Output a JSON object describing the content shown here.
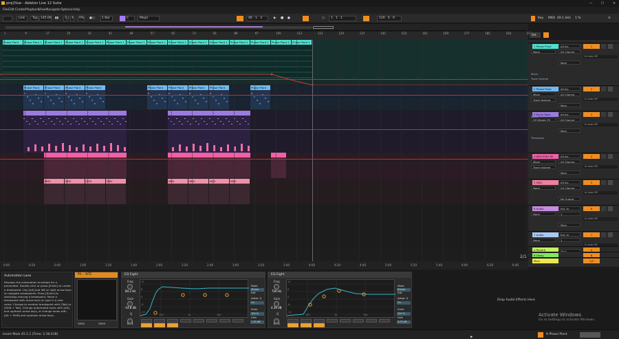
{
  "window": {
    "title": "proj2Vue - Ableton Live 12 Suite",
    "min": "—",
    "max": "☐",
    "close": "✕"
  },
  "menu": [
    "File",
    "Edit",
    "Create",
    "Playback",
    "View",
    "Navigate",
    "Options",
    "Help"
  ],
  "transport": {
    "link": "Link",
    "tap": "Tap",
    "tempo": "145.00",
    "sig_num": "3",
    "sig_den": "4",
    "swing": "0%",
    "quant": "1 Bar",
    "key": "C",
    "scale": "Major",
    "pos": "46 . 1 . 3",
    "loop_start": "1 . 1 . 1",
    "loop_len": "120 . 0 . 0",
    "key_btn": "Key",
    "midi_btn": "MIDI",
    "cpu": "49.1 kHz",
    "cpu_pct": "1 %"
  },
  "ruler": [
    "1",
    "9",
    "17",
    "25",
    "33",
    "41",
    "49",
    "57",
    "65",
    "73",
    "81",
    "89",
    "97",
    "105",
    "113",
    "121",
    "129",
    "137",
    "145",
    "153",
    "161",
    "169",
    "177",
    "185",
    "193",
    "201"
  ],
  "timeline": [
    "0:00",
    "0:20",
    "0:40",
    "1:00",
    "1:20",
    "1:40",
    "2:00",
    "2:20",
    "2:40",
    "3:00",
    "3:20",
    "3:40",
    "4:00",
    "4:20",
    "4:40",
    "5:00",
    "5:20",
    "5:40",
    "6:00",
    "6:20",
    "6:40",
    "7:00",
    "7:20"
  ],
  "page_indicator": "2/1",
  "clips": {
    "phase": "Phase Plant",
    "phase1": "Phase Plant 1",
    "midi": "MIDI"
  },
  "set_label": "Set",
  "tracks": [
    {
      "name": "1 Phase Plant",
      "color": "#4fe0d0",
      "input": "All Ins",
      "ch": "All Channe",
      "out": "Main",
      "num": "1",
      "extra1": "Mixer",
      "extra2": "Track Volume",
      "mode": "None"
    },
    {
      "name": "2 Phase Plant",
      "color": "#6fb9f0",
      "input": "All Ins",
      "ch": "All Channe",
      "out": "Main",
      "num": "2",
      "extra1": "Mixer",
      "extra2": "Track Volume",
      "mode": "Mixer"
    },
    {
      "name": "3 Drum Rack",
      "color": "#9b7be0",
      "input": "All Ins",
      "ch": "All Channe",
      "out": "Main",
      "num": "3",
      "extra1": "Transpose",
      "extra2": "",
      "mode": "OH Money Fil"
    },
    {
      "name": "4 808 FERO 80",
      "color": "#f060a8",
      "input": "All Ins",
      "ch": "All Channe",
      "out": "Main",
      "num": "4",
      "extra1": "",
      "extra2": "Track Volume",
      "mode": "Mixer"
    },
    {
      "name": "5 MIDI",
      "color": "#f07fa0",
      "input": "All Ins",
      "ch": "All Channe",
      "out": "No Output",
      "num": "5",
      "extra1": "",
      "extra2": "",
      "mode": "None"
    },
    {
      "name": "6 Audio",
      "color": "#c78be0",
      "input": "Ext. In",
      "ch": "1",
      "out": "Main",
      "num": "6",
      "extra1": "",
      "extra2": "",
      "mode": "None"
    },
    {
      "name": "7 Audio",
      "color": "#a8c8f0",
      "input": "Ext. In",
      "ch": "1",
      "out": "Main",
      "num": "7",
      "extra1": "",
      "extra2": "",
      "mode": "None"
    },
    {
      "name": "A Reverb",
      "color": "#c4f060",
      "input": "",
      "ch": "",
      "out": "",
      "num": "A",
      "extra1": "",
      "extra2": "",
      "mode": ""
    },
    {
      "name": "B Delay",
      "color": "#80e860",
      "input": "",
      "ch": "",
      "out": "",
      "num": "B",
      "extra1": "",
      "extra2": "",
      "mode": ""
    },
    {
      "name": "Main",
      "color": "#e8e850",
      "input": "",
      "ch": "",
      "out": "",
      "num": "1/2",
      "extra1": "",
      "extra2": "",
      "mode": ""
    }
  ],
  "info": {
    "title": "Automation Lane",
    "body": "Displays the automation envelope for a parameter. Double-click or press [Enter] to create a breakpoint. Use [Alt] and left or right arrow keys to navigate breakpoints. Press [Enter] to start/stop moving a breakpoint. Move a breakpoint with arrow keys or type in a new value. Change to another breakpoint with [Tab] or [Shift + Tab]. Change automated lanes with [Alt] and up/down arrow keys, or change lanes with [Alt + Shift] and up/down arrow keys."
  },
  "device_rack": {
    "name": "Ph... NTE",
    "none1": "none",
    "none2": "none"
  },
  "eq1": {
    "title": "EQ Eight",
    "freq_label": "Freq",
    "freq": "84.2 Hz",
    "gain_label": "Gain",
    "gain": "-14.8 dB",
    "q_label": "Q",
    "q": "0.71",
    "mode": "Mode",
    "mode_val": "Stereo",
    "edit": "Edit",
    "adapt": "Adapt. Q",
    "adapt_val": "On",
    "scale": "Scale",
    "scale_val": "100 %",
    "gain_out": "Gain",
    "gain_out_val": "1.30 dB",
    "db_ticks": [
      "12",
      "6",
      "0",
      "-6",
      "-12"
    ],
    "hz_ticks": [
      "100",
      "1k",
      "10k"
    ]
  },
  "eq2": {
    "title": "EQ Eight",
    "freq_label": "Freq",
    "freq": "726 Hz",
    "gain_label": "Gain",
    "gain": "4.39 dB",
    "q_label": "Q",
    "q": "0.71",
    "mode": "Mode",
    "mode_val": "Stereo",
    "edit": "Edit",
    "adapt": "Adapt. Q",
    "adapt_val": "On",
    "scale": "Scale",
    "scale_val": "100 %",
    "gain_out": "Gain",
    "gain_out_val": "0.00 dB",
    "db_ticks": [
      "12",
      "6",
      "0",
      "-6",
      "-12"
    ],
    "hz_ticks": [
      "100",
      "1k",
      "10k"
    ]
  },
  "drop_text": "Drop Audio Effects Here",
  "activate": {
    "title": "Activate Windows",
    "sub": "Go to Settings to activate Windows."
  },
  "status": {
    "left": "Insert Mark 45.1.1 (Time: 1:30.418)",
    "right": "6-Phase Plant"
  }
}
